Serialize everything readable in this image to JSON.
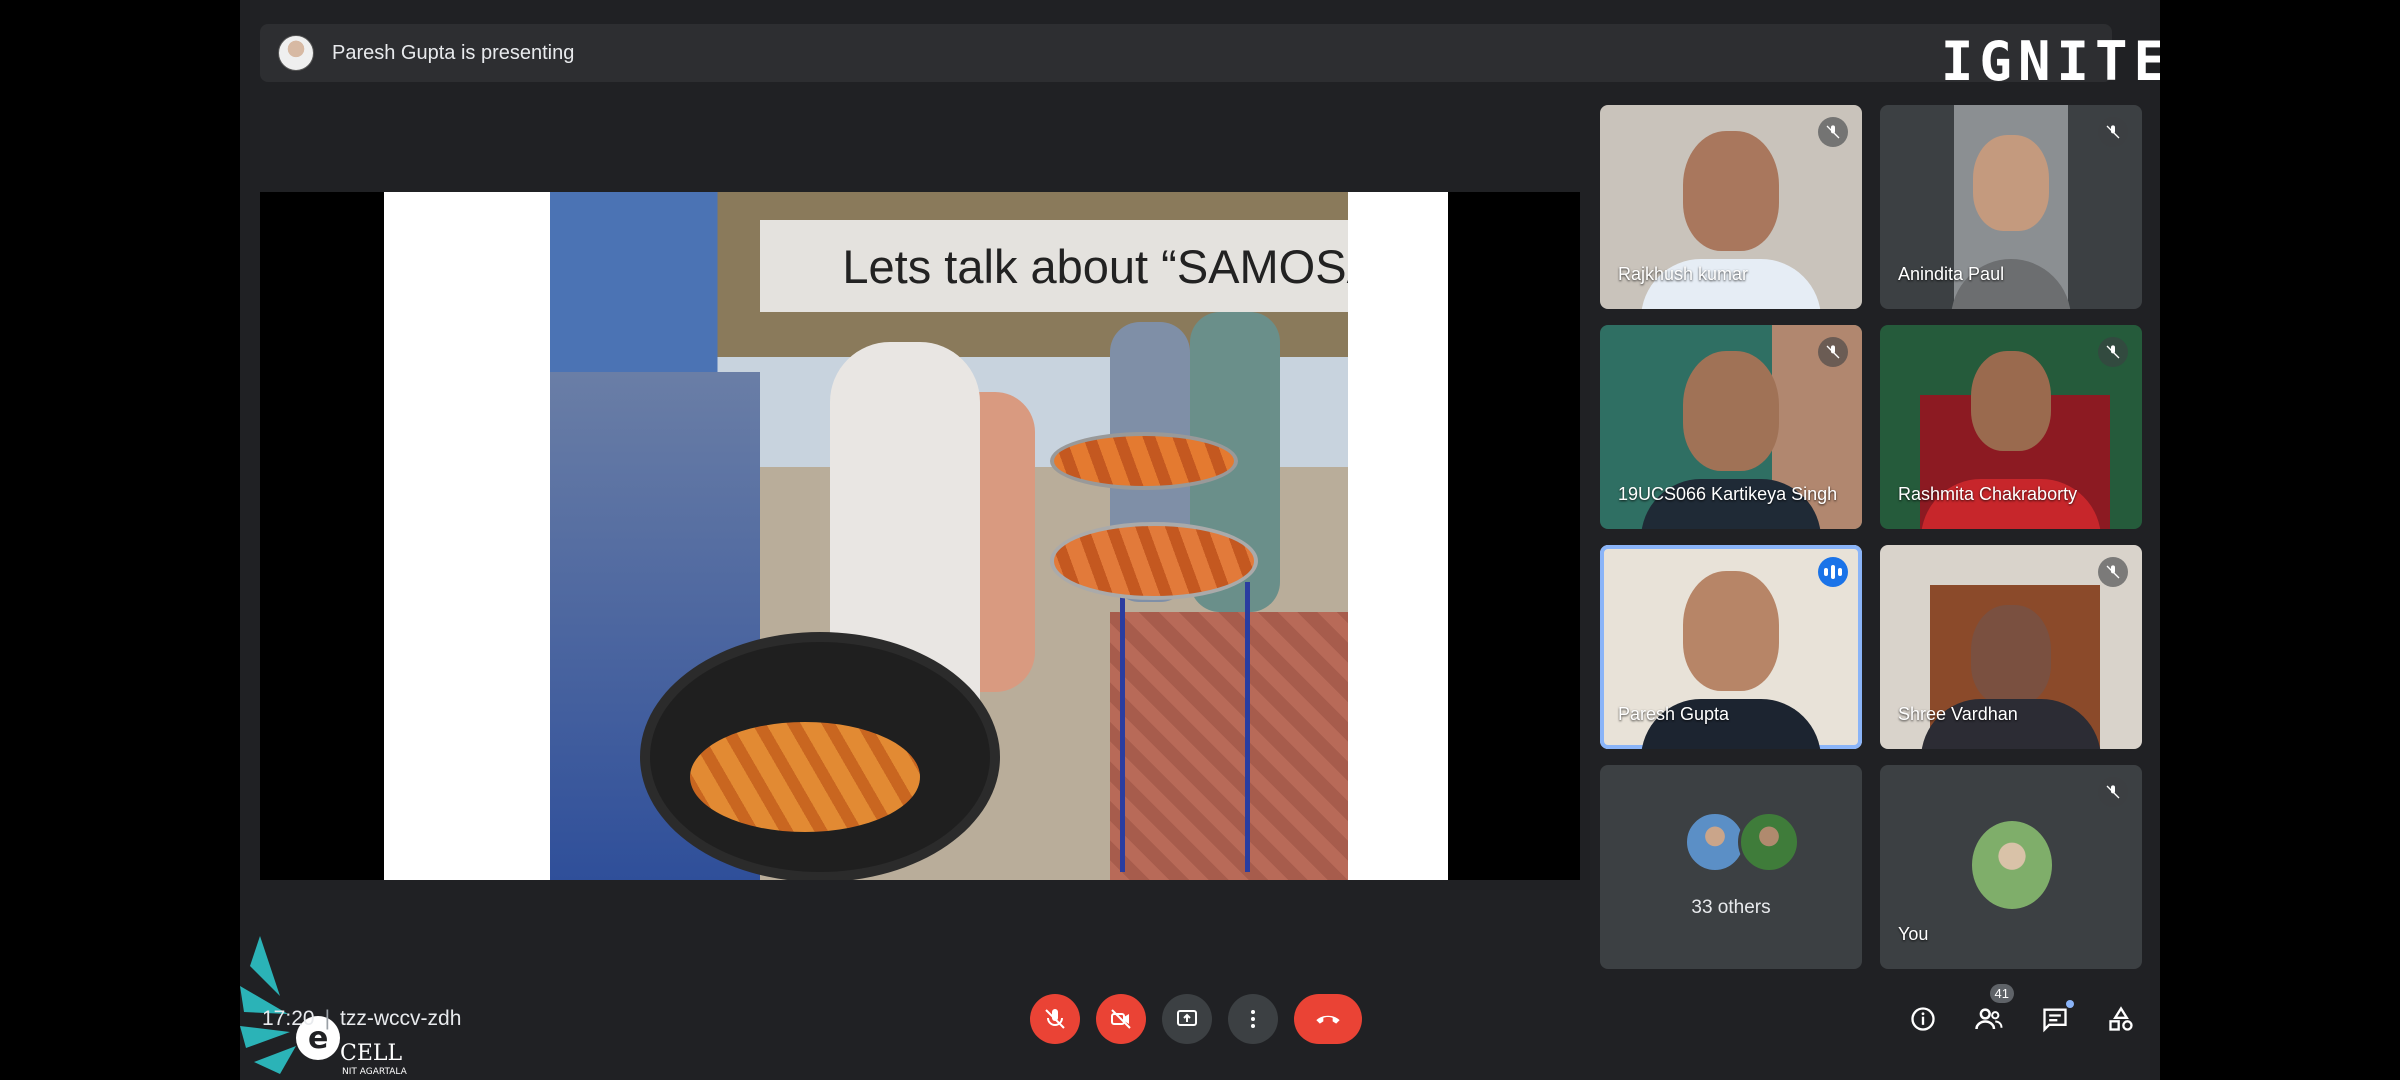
{
  "presenting_bar": {
    "text": "Paresh Gupta is presenting"
  },
  "brand": {
    "ignite": "IGNITE",
    "ecell_main": "CELL",
    "ecell_sub": "NIT AGARTALA",
    "ecell_letter": "e"
  },
  "slide": {
    "title": "Lets talk about “SAMOSA”"
  },
  "participants": [
    {
      "name": "Rajkhush kumar",
      "muted": true
    },
    {
      "name": "Anindita Paul",
      "muted": true
    },
    {
      "name": "19UCS066 Kartikeya Singh",
      "muted": true
    },
    {
      "name": "Rashmita Chakraborty",
      "muted": true
    },
    {
      "name": "Paresh Gupta",
      "muted": false,
      "speaking": true
    },
    {
      "name": "Shree Vardhan",
      "muted": true
    }
  ],
  "others": {
    "label": "33 others"
  },
  "you": {
    "label": "You",
    "muted": true
  },
  "meeting": {
    "time": "17:20",
    "separator": "|",
    "code": "tzz-wccv-zdh"
  },
  "controls": [
    "mic-off",
    "camera-off",
    "present",
    "more",
    "end-call"
  ],
  "right_panel": {
    "people_count": "41"
  },
  "colors": {
    "bg": "#202124",
    "tile": "#3c4043",
    "danger": "#ea4335",
    "accent": "#8ab4f8"
  }
}
